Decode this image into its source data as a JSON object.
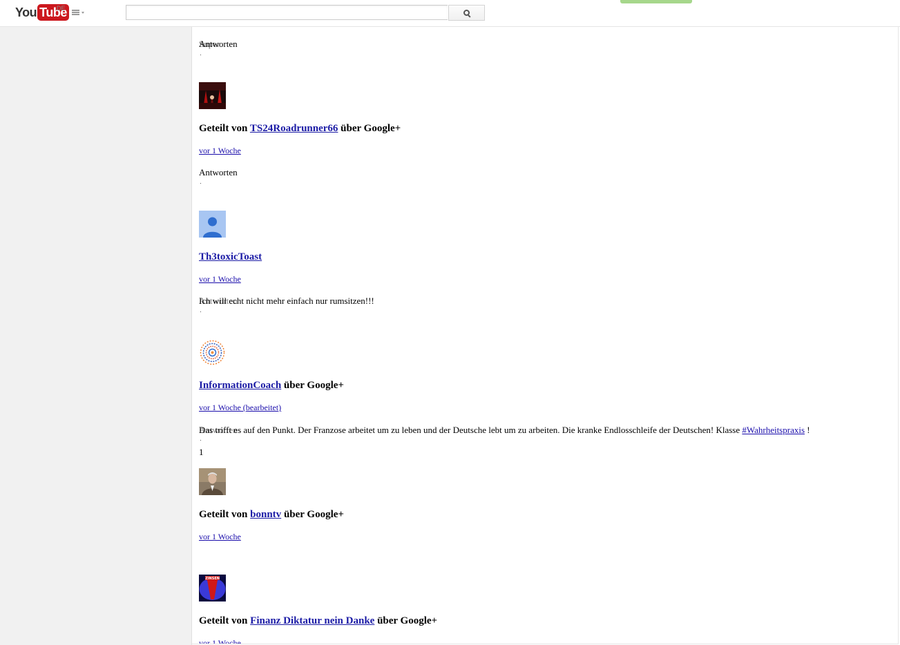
{
  "masthead": {
    "logo_you": "You",
    "logo_tube": "Tube",
    "region": "DE",
    "search_placeholder": "",
    "search_value": ""
  },
  "comments": {
    "top": {
      "reply": "Antworten",
      "overlap": "Super"
    },
    "c1": {
      "prefix": "Geteilt von ",
      "author": "TS24Roadrunner66",
      "suffix": " über Google+",
      "time": "vor 1 Woche",
      "reply": "Antworten"
    },
    "c2": {
      "author": "Th3toxicToast",
      "time": "vor 1 Woche",
      "reply": "Antworten",
      "body": "Ich will echt nicht mehr einfach nur rumsitzen!!!"
    },
    "c3": {
      "author": "InformationCoach",
      "suffix": " über Google+",
      "time": "vor 1 Woche (bearbeitet)",
      "reply": "Antworten",
      "body_lead": "Das trifft es auf den Punkt. Der Franzose arbeitet um zu leben und der Deutsche lebt um zu arbeiten. Die kranke Endlosschleife der Deutschen! Klasse ",
      "hashtag": "#Wahrheitspraxis",
      "body_tail": " !",
      "likes": "1"
    },
    "c4": {
      "prefix": "Geteilt von ",
      "author": "bonntv",
      "suffix": " über Google+",
      "time": "vor 1 Woche"
    },
    "c5": {
      "prefix": "Geteilt von ",
      "author": "Finanz Diktatur nein Danke",
      "suffix": " über Google+",
      "time": "vor 1 Woche",
      "avatar_text": "ZINSEN"
    }
  },
  "colors": {
    "youtube_red": "#cc181e",
    "link_blue": "#1a0dab",
    "guide_bg": "#f1f1f1",
    "upload_green": "#a6d78c"
  }
}
